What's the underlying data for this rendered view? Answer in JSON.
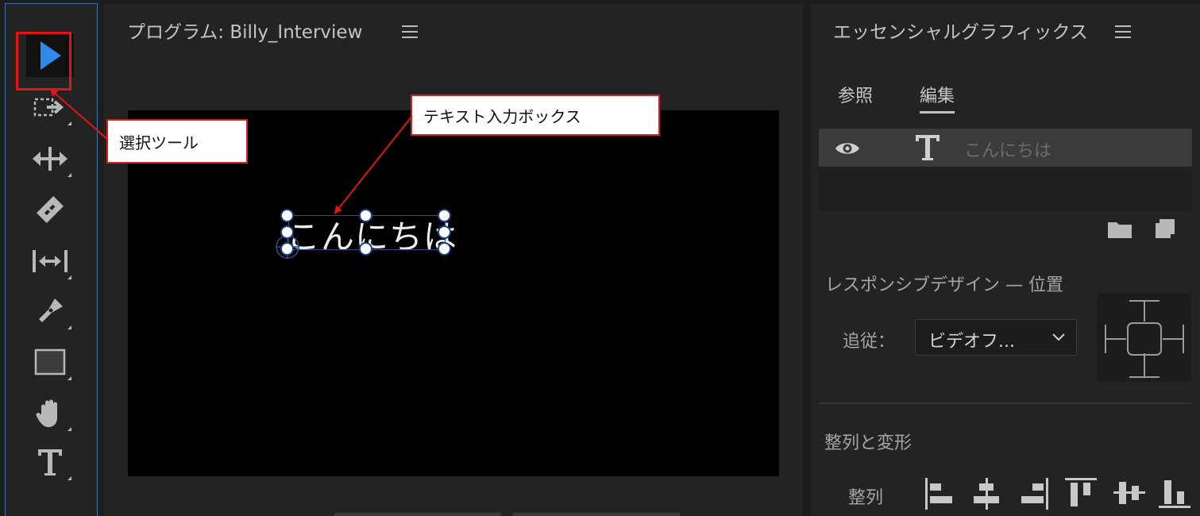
{
  "program": {
    "title": "プログラム: Billy_Interview",
    "viewer_text": "こんにちは"
  },
  "essential_graphics": {
    "title": "エッセンシャルグラフィックス",
    "tabs": [
      "参照",
      "編集"
    ],
    "active_tab": "編集",
    "layer": {
      "name": "こんにちは",
      "type_icon": "text-T-icon",
      "visibility_icon": "eye-icon"
    },
    "responsive_design_label": "レスポンシブデザイン — 位置",
    "follow_label": "追従：",
    "follow_value": "ビデオフ...",
    "align_transform_label": "整列と変形",
    "align_label": "整列"
  },
  "tools": [
    "selection-tool",
    "track-select-tool",
    "ripple-edit-tool",
    "razor-tool",
    "slip-tool",
    "pen-tool",
    "rectangle-tool",
    "hand-tool",
    "type-tool"
  ],
  "callouts": {
    "selection_tool": "選択ツール",
    "text_box": "テキスト入力ボックス"
  },
  "colors": {
    "selected_tool_accent": "#2d8ceb",
    "callout_border": "#e01515",
    "panel_background": "#232323",
    "focus_border": "#3b6fb0"
  }
}
